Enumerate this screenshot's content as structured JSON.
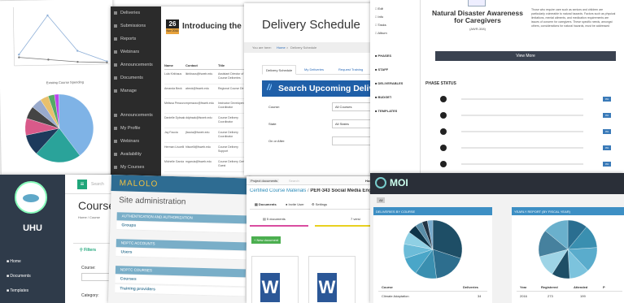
{
  "p1": {
    "pie_title": "Existing Course Spending",
    "line_y_label": "",
    "pie_labels": [
      "",
      "",
      "",
      "",
      ""
    ]
  },
  "p2": {
    "date_num": "26",
    "date_mon": "Nov 2016",
    "title": "Introducing the NDP",
    "side": [
      "Deliveries",
      "Submissions",
      "Reports",
      "Webinars",
      "Announcements",
      "Documents",
      "Manage",
      "Announcements",
      "My Profile",
      "Webinars",
      "Availability",
      "My Courses",
      "Documents"
    ],
    "cols": [
      "Name",
      "Contact",
      "Title"
    ],
    "rows": [
      [
        "Lola Kirkhaus",
        "lkirkhaus@fsweb.edu",
        "Assistant Director of Course Deliveries"
      ],
      [
        "Amanda Beck",
        "abeck@fsweb.edu",
        "Regional Course Dir"
      ],
      [
        "Melissa Perazzo",
        "mperazzo@fsweb.edu",
        "Instructor Development Coordinator"
      ],
      [
        "Danielle Dybsak",
        "ddybsak@fsweb.edu",
        "Course Delivery Coordinator"
      ],
      [
        "Jay Faccia",
        "jfaccia@fsweb.edu",
        "Course Delivery Coordinator"
      ],
      [
        "Herman Lisoelli",
        "hlisoelli@fsweb.edu",
        "Course Delivery Support"
      ],
      [
        "Michelle Garcia",
        "mgarcia@fsweb.edu",
        "Course Delivery Cert Guest"
      ]
    ]
  },
  "p3": {
    "header": "Delivery Schedule",
    "crumb_pre": "You are here:",
    "crumb_home": "Home",
    "crumb_sep": ">",
    "crumb_page": "Delivery Schedule",
    "tabs": [
      "Delivery Schedule",
      "My Deliveries",
      "Request Training"
    ],
    "search_title": "Search Upcoming Deliveries",
    "slash": "//",
    "fields": [
      {
        "label": "Course:",
        "value": "All Courses"
      },
      {
        "label": "State:",
        "value": "All States"
      },
      {
        "label": "On or After:",
        "value": ""
      }
    ]
  },
  "p4": {
    "nav": [
      "Edit",
      "Info",
      "Tasks",
      "Album"
    ],
    "nav2": [
      "PHASES",
      "STAFF",
      "DELIVERABLES",
      "BUDGET",
      "TEMPLATES"
    ],
    "card_title": "Natural Disaster Awareness for Caregivers",
    "card_code": "(AWR-308)",
    "card_text": "Those who require care such as seniors and children are particularly vulnerable to natural hazards. Factors such as physical limitations, mental ailments, and medication requirements are issues of concern for caregivers. These specific needs, amongst others, considerations for natural hazards, must be addressed",
    "view_more": "View More",
    "phase_status": "PHASE STATUS",
    "badge": "0%"
  },
  "p5": {
    "logo": "UHU",
    "search": "Search",
    "title": "Course",
    "crumb": "Home / Course",
    "filters": "Filters",
    "course_label": "Course:",
    "category_label": "Category:",
    "menu": [
      "Home",
      "Documents",
      "Templates"
    ]
  },
  "p6": {
    "brand": "MALOLO",
    "title": "Site administration",
    "sections": [
      {
        "head": "AUTHENTICATION AND AUTHORIZATION",
        "links": [
          "Groups"
        ]
      },
      {
        "head": "NDPTC ACCOUNTS",
        "links": [
          "Users"
        ]
      },
      {
        "head": "NDPTC COURSES",
        "links": [
          "Courses",
          "Training providers"
        ]
      }
    ]
  },
  "p7": {
    "top_tab": "Project documents",
    "search": "Search",
    "user": "Hom",
    "crumb_link": "Certified Course Materials",
    "crumb_sep": "/",
    "crumb_page": "PER-343 Social Media Eng",
    "tabs": [
      "Documents",
      "Invite User",
      "Settings"
    ],
    "docs_count": "5 documents",
    "docs_count2": "7 versi",
    "new_doc": "+ New document"
  },
  "p8": {
    "brand": "MOI",
    "tab": "All",
    "left_title": "DELIVERIES BY COURSE",
    "right_title": "YEARLY REPORT (BY FISCAL YEAR)",
    "left_cols": [
      "Course",
      "Deliveries"
    ],
    "left_row": [
      "Climate Adaptation",
      "34"
    ],
    "right_cols": [
      "Year",
      "Registered",
      "Attended",
      "P"
    ],
    "right_row": [
      "2016",
      "273",
      "199"
    ],
    "left_slices": [
      "Tsunami",
      "Flood",
      "Coastal",
      "Earthquake"
    ],
    "right_slices": [
      "2016 11%",
      "2011 13%",
      "2014 14%",
      "2015 11%",
      "2012 10%",
      "2013 12%"
    ]
  },
  "chart_data": [
    {
      "type": "line",
      "title": "",
      "series": [
        {
          "name": "",
          "values": [
            0.2,
            0.9,
            0.25,
            0.05
          ]
        },
        {
          "name": "",
          "values": [
            0.15,
            0.1,
            0.05,
            0.03
          ]
        }
      ]
    },
    {
      "type": "pie",
      "title": "Existing Course Spending",
      "values": [
        40,
        22,
        10,
        8,
        6,
        5,
        4,
        3,
        2
      ]
    },
    {
      "type": "pie",
      "title": "DELIVERIES BY COURSE",
      "values": [
        30,
        18,
        12,
        10,
        8,
        7,
        5,
        4,
        3,
        3
      ]
    },
    {
      "type": "pie",
      "title": "YEARLY REPORT (BY FISCAL YEAR)",
      "values": [
        11,
        13,
        14,
        11,
        10,
        12,
        15,
        14
      ]
    }
  ]
}
